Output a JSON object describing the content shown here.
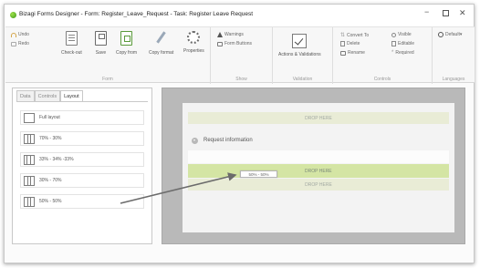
{
  "window": {
    "title": "Bizagi Forms Designer - Form: Register_Leave_Request - Task: Register Leave Request",
    "controls": {
      "minimize": "−",
      "close": "✕"
    }
  },
  "ribbon": {
    "form_group": {
      "label": "Form",
      "undo": "Undo",
      "redo": "Redo",
      "checkout": "Check-out",
      "save": "Save",
      "copy_from": "Copy from",
      "copy_format": "Copy format",
      "properties": "Properties"
    },
    "show_group": {
      "label": "Show",
      "warnings": "Warnings",
      "form_buttons": "Form Buttons"
    },
    "validation_group": {
      "label": "Validation",
      "actions_validations": "Actions & Validations"
    },
    "controls_group": {
      "label": "Controls",
      "convert_to": "Convert To",
      "delete": "Delete",
      "rename": "Rename",
      "visible": "Visible",
      "editable": "Editable",
      "required": "Required"
    },
    "languages_group": {
      "label": "Languages",
      "default": "Default▾"
    }
  },
  "left_panel": {
    "tabs": [
      "Data",
      "Controls",
      "Layout"
    ],
    "active_tab": "Layout",
    "layouts": [
      {
        "label": "Full layout",
        "icon": "layout-full-icon"
      },
      {
        "label": "70% - 30%",
        "icon": "layout-two-col-icon"
      },
      {
        "label": "33% - 34% -33%",
        "icon": "layout-three-col-icon"
      },
      {
        "label": "30% - 70%",
        "icon": "layout-two-col-icon"
      },
      {
        "label": "50% - 50%",
        "icon": "layout-two-col-icon"
      }
    ]
  },
  "canvas": {
    "drop_here": "DROP HERE",
    "group_title": "Request information",
    "drag_ghost": "50% - 50%"
  },
  "colors": {
    "drop_zone": "#e9ecd6",
    "drop_zone_active": "#d4e5a4",
    "canvas_bg": "#b9b9b9",
    "arrow": "#6b6b6b"
  }
}
